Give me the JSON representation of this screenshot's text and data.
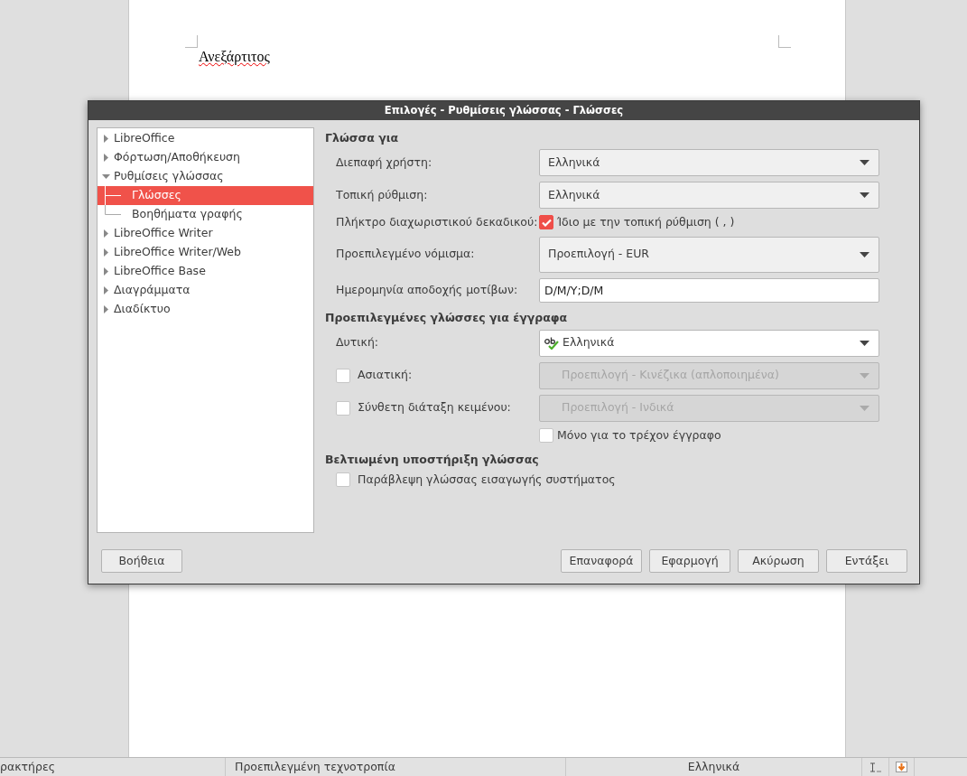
{
  "document": {
    "text": "Ανεξάρτιτος"
  },
  "dialog": {
    "title": "Επιλογές - Ρυθμίσεις γλώσσας - Γλώσσες",
    "tree": [
      {
        "label": "LibreOffice",
        "expanded": false,
        "selected": false
      },
      {
        "label": "Φόρτωση/Αποθήκευση",
        "expanded": false,
        "selected": false
      },
      {
        "label": "Ρυθμίσεις γλώσσας",
        "expanded": true,
        "selected": false,
        "children": [
          {
            "label": "Γλώσσες",
            "selected": true
          },
          {
            "label": "Βοηθήματα γραφής",
            "selected": false
          }
        ]
      },
      {
        "label": "LibreOffice Writer",
        "expanded": false,
        "selected": false
      },
      {
        "label": "LibreOffice Writer/Web",
        "expanded": false,
        "selected": false
      },
      {
        "label": "LibreOffice Base",
        "expanded": false,
        "selected": false
      },
      {
        "label": "Διαγράμματα",
        "expanded": false,
        "selected": false
      },
      {
        "label": "Διαδίκτυο",
        "expanded": false,
        "selected": false
      }
    ],
    "sections": [
      {
        "heading": "Γλώσσα για",
        "rows": [
          {
            "kind": "combo",
            "label": "Διεπαφή χρήστη:",
            "value": "Ελληνικά"
          },
          {
            "kind": "combo",
            "label": "Τοπική ρύθμιση:",
            "value": "Ελληνικά"
          },
          {
            "kind": "check",
            "label": "Πλήκτρο διαχωριστικού δεκαδικού:",
            "check_label": "Ίδιο με την τοπική ρύθμιση ( , )",
            "checked": true
          },
          {
            "kind": "combo",
            "label": "Προεπιλεγμένο νόμισμα:",
            "value": "Προεπιλογή - EUR"
          },
          {
            "kind": "input",
            "label": "Ημερομηνία αποδοχής μοτίβων:",
            "value": "D/M/Y;D/M"
          }
        ]
      },
      {
        "heading": "Προεπιλεγμένες γλώσσες για έγγραφα",
        "rows": [
          {
            "kind": "lang-combo",
            "label": "Δυτική:",
            "value": "Ελληνικά"
          },
          {
            "kind": "check-combo",
            "label": "Ασιατική:",
            "checked": false,
            "value": "Προεπιλογή - Κινέζικα (απλοποιημένα)",
            "disabled": true
          },
          {
            "kind": "check-combo",
            "label": "Σύνθετη διάταξη κειμένου:",
            "checked": false,
            "value": "Προεπιλογή - Ινδικά",
            "disabled": true
          },
          {
            "kind": "check",
            "label": "",
            "check_label": "Μόνο για το τρέχον έγγραφο",
            "checked": false
          }
        ]
      },
      {
        "heading": "Βελτιωμένη υποστήριξη γλώσσας",
        "rows": [
          {
            "kind": "check-row",
            "check_label": "Παράβλεψη γλώσσας εισαγωγής συστήματος",
            "checked": false
          }
        ]
      }
    ],
    "buttons_left": [
      "Βοήθεια"
    ],
    "buttons_right": [
      "Επαναφορά",
      "Εφαρμογή",
      "Ακύρωση",
      "Εντάξει"
    ]
  },
  "status_bar": {
    "word_count": "ρακτήρες",
    "page_style": "Προεπιλεγμένη τεχνοτροπία",
    "language": "Ελληνικά"
  }
}
